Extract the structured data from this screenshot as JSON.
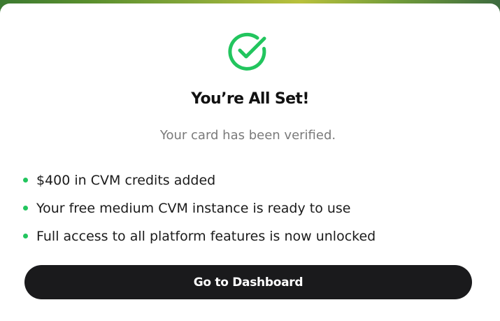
{
  "modal": {
    "title": "You’re All Set!",
    "subtitle": "Your card has been verified.",
    "features": [
      "$400 in CVM credits added",
      "Your free medium CVM instance is ready to use",
      "Full access to all platform features is now unlocked"
    ],
    "cta_label": "Go to Dashboard",
    "success_icon": "check-circle-icon"
  },
  "colors": {
    "accent_green": "#22c55e",
    "button_bg": "#1a1a1c",
    "title_text": "#111111",
    "subtitle_text": "#7a7a7a"
  }
}
